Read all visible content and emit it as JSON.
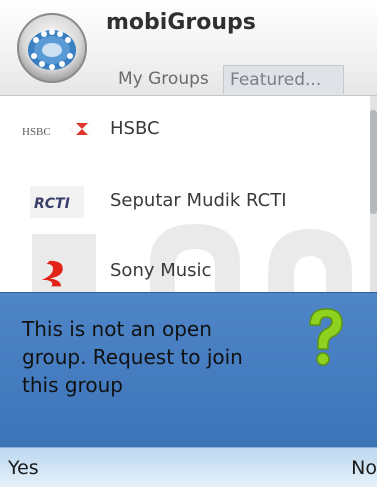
{
  "app": {
    "title": "mobiGroups"
  },
  "tabs": [
    {
      "label": "My Groups",
      "active": false
    },
    {
      "label": "Featured...",
      "active": true
    }
  ],
  "groups": [
    {
      "name": "HSBC",
      "logo_text": "HSBC"
    },
    {
      "name": "Seputar Mudik RCTI",
      "logo_text": "RCTI"
    },
    {
      "name": "Sony Music"
    }
  ],
  "dialog": {
    "message": "This is not an open group. Request to join this group",
    "icon": "question-mark-icon"
  },
  "softkeys": {
    "left": "Yes",
    "right": "No"
  },
  "colors": {
    "dialog_bg": "#4a80c2",
    "softkey_bg": "#d6e8f6",
    "question_green": "#8fd11f"
  }
}
